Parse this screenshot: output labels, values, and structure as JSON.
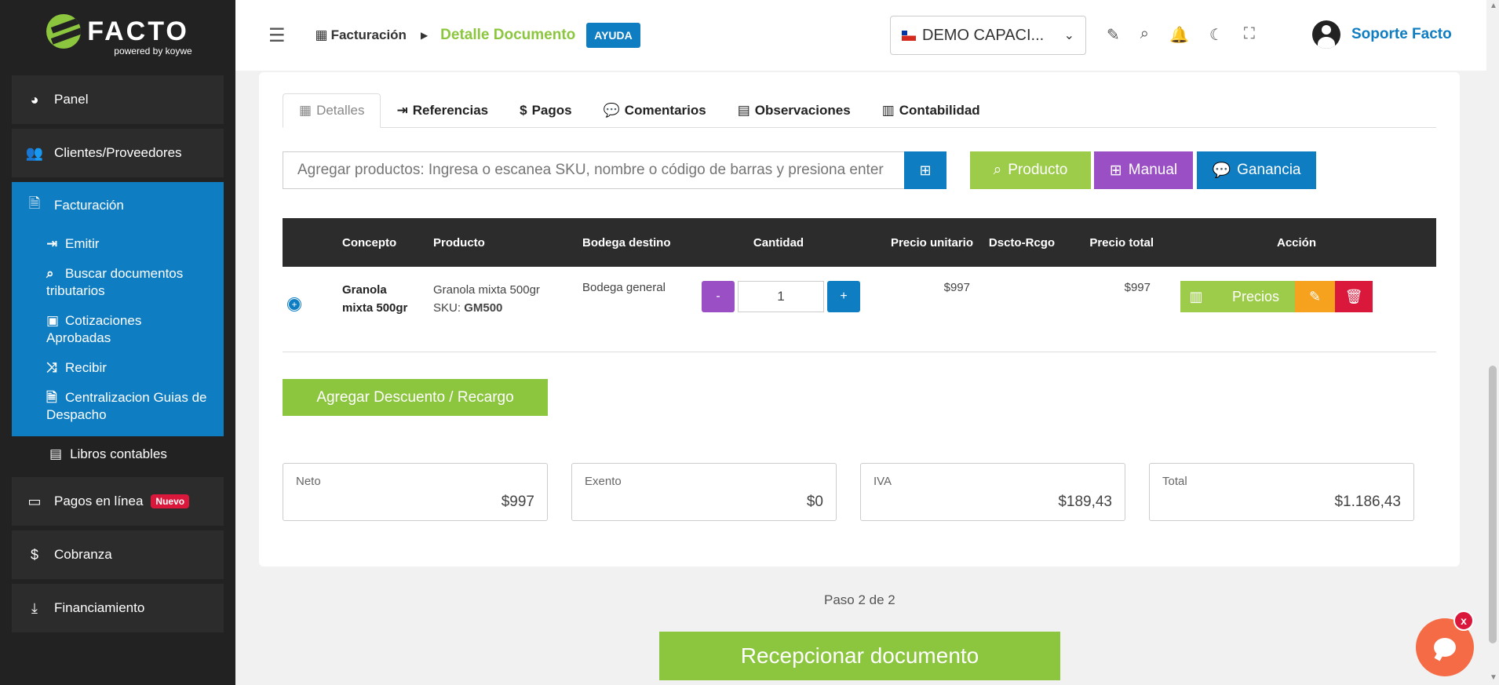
{
  "brand": {
    "name": "FACTO",
    "powered": "powered by koywe"
  },
  "sidebar": {
    "items": [
      {
        "label": "Panel"
      },
      {
        "label": "Clientes/Proveedores"
      }
    ],
    "active": {
      "label": "Facturación",
      "sub": [
        {
          "label": "Emitir"
        },
        {
          "label": "Buscar documentos tributarios"
        },
        {
          "label": "Cotizaciones Aprobadas"
        },
        {
          "label": "Recibir"
        },
        {
          "label": "Centralizacion Guias de Despacho"
        }
      ]
    },
    "libros": "Libros contables",
    "bottom": [
      {
        "label": "Pagos en línea",
        "badge": "Nuevo"
      },
      {
        "label": "Cobranza"
      },
      {
        "label": "Financiamiento"
      }
    ]
  },
  "header": {
    "crumb1": "Facturación",
    "crumb2": "Detalle Documento",
    "help": "AYUDA",
    "company": "DEMO CAPACI...",
    "user": "Soporte Facto"
  },
  "tabs": [
    {
      "label": "Detalles",
      "icon": "table-icon"
    },
    {
      "label": "Referencias",
      "icon": "reference-icon"
    },
    {
      "label": "Pagos",
      "icon": "dollar-icon"
    },
    {
      "label": "Comentarios",
      "icon": "comments-icon"
    },
    {
      "label": "Observaciones",
      "icon": "book-icon"
    },
    {
      "label": "Contabilidad",
      "icon": "calculator-icon"
    }
  ],
  "search": {
    "placeholder": "Agregar productos: Ingresa o escanea SKU, nombre o código de barras y presiona enter"
  },
  "buttons": {
    "producto": "Producto",
    "manual": "Manual",
    "ganancia": "Ganancia",
    "descuento": "Agregar Descuento / Recargo",
    "recepcionar": "Recepcionar documento"
  },
  "table": {
    "headers": [
      "Concepto",
      "Producto",
      "Bodega destino",
      "Cantidad",
      "Precio unitario",
      "Dscto-Rcgo",
      "Precio total",
      "Acción"
    ],
    "rows": [
      {
        "concepto": "Granola mixta 500gr",
        "producto": "Granola mixta 500gr",
        "sku_label": "SKU:",
        "sku": "GM500",
        "bodega": "Bodega general",
        "cantidad": "1",
        "precio_unitario": "$997",
        "dscto": "",
        "precio_total": "$997",
        "precios_label": "Precios"
      }
    ]
  },
  "totals": [
    {
      "label": "Neto",
      "value": "$997"
    },
    {
      "label": "Exento",
      "value": "$0"
    },
    {
      "label": "IVA",
      "value": "$189,43"
    },
    {
      "label": "Total",
      "value": "$1.186,43"
    }
  ],
  "step": "Paso 2 de 2",
  "chat": {
    "close": "x"
  },
  "colors": {
    "brand_blue": "#0f7dc2",
    "brand_green": "#8cc63f",
    "purple": "#9a50c4",
    "red": "#d9183b",
    "orange": "#f6a21e"
  }
}
